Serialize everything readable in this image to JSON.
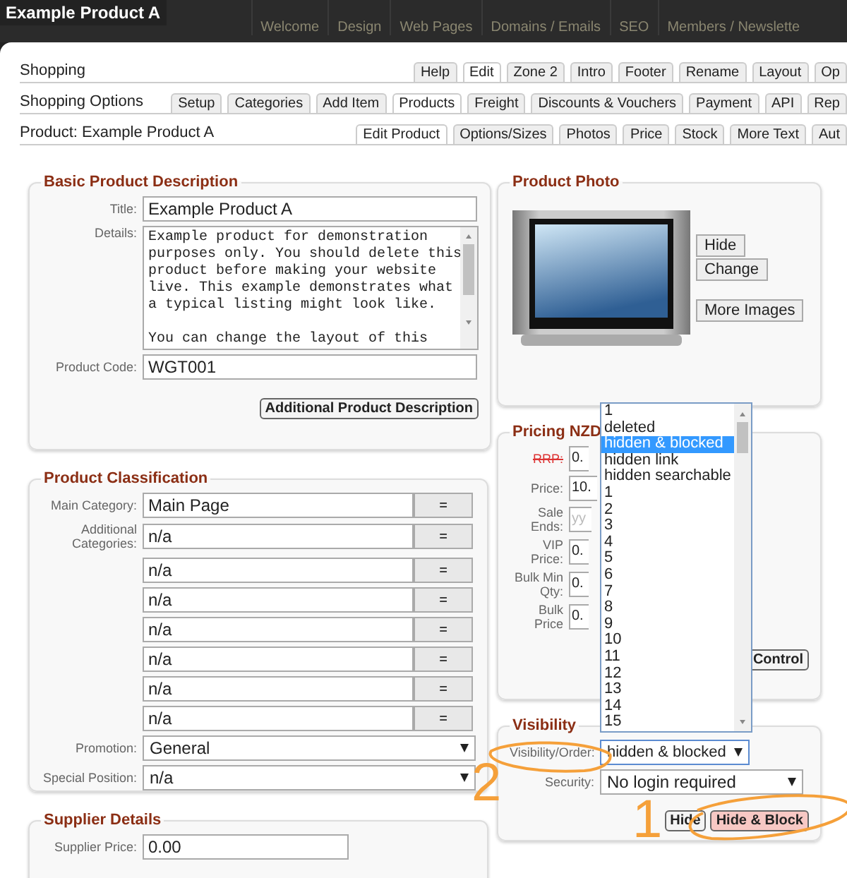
{
  "header": {
    "title": "Example Product A",
    "nav": [
      "Welcome",
      "Design",
      "Web Pages",
      "Domains / Emails",
      "SEO",
      "Members / Newslette"
    ]
  },
  "tab_rows": [
    {
      "label": "Shopping",
      "tabs": [
        {
          "label": "Help",
          "selected": false
        },
        {
          "label": "Edit",
          "selected": true
        },
        {
          "label": "Zone 2",
          "selected": false
        },
        {
          "label": "Intro",
          "selected": false
        },
        {
          "label": "Footer",
          "selected": false
        },
        {
          "label": "Rename",
          "selected": false
        },
        {
          "label": "Layout",
          "selected": false
        },
        {
          "label": "Op",
          "selected": false
        }
      ]
    },
    {
      "label": "Shopping Options",
      "tabs": [
        {
          "label": "Setup",
          "selected": false
        },
        {
          "label": "Categories",
          "selected": false
        },
        {
          "label": "Add Item",
          "selected": false
        },
        {
          "label": "Products",
          "selected": true
        },
        {
          "label": "Freight",
          "selected": false
        },
        {
          "label": "Discounts & Vouchers",
          "selected": false
        },
        {
          "label": "Payment",
          "selected": false
        },
        {
          "label": "API",
          "selected": false
        },
        {
          "label": "Rep",
          "selected": false
        }
      ]
    },
    {
      "label": "Product: Example Product A",
      "tabs": [
        {
          "label": "Edit Product",
          "selected": true
        },
        {
          "label": "Options/Sizes",
          "selected": false
        },
        {
          "label": "Photos",
          "selected": false
        },
        {
          "label": "Price",
          "selected": false
        },
        {
          "label": "Stock",
          "selected": false
        },
        {
          "label": "More Text",
          "selected": false
        },
        {
          "label": "Aut",
          "selected": false
        }
      ]
    }
  ],
  "basic": {
    "legend": "Basic Product Description",
    "title": {
      "label": "Title:",
      "value": "Example Product A"
    },
    "details": {
      "label": "Details:",
      "value": "Example product for demonstration\npurposes only. You should delete this\nproduct before making your website\nlive. This example demonstrates what\na typical listing might look like.\n\nYou can change the layout of this"
    },
    "code": {
      "label": "Product Code:",
      "value": "WGT001"
    },
    "button": "Additional Product Description"
  },
  "photo": {
    "legend": "Product Photo",
    "buttons": [
      "Hide",
      "Change",
      "More Images"
    ]
  },
  "classification": {
    "legend": "Product Classification",
    "main": {
      "label": "Main Category:",
      "value": "Main Page",
      "button": "="
    },
    "additional_label": "Additional Categories:",
    "additional": [
      {
        "value": "n/a",
        "button": "="
      },
      {
        "value": "n/a",
        "button": "="
      },
      {
        "value": "n/a",
        "button": "="
      },
      {
        "value": "n/a",
        "button": "="
      },
      {
        "value": "n/a",
        "button": "="
      },
      {
        "value": "n/a",
        "button": "="
      },
      {
        "value": "n/a",
        "button": "="
      }
    ],
    "promotion": {
      "label": "Promotion:",
      "value": "General"
    },
    "special": {
      "label": "Special Position:",
      "value": "n/a"
    }
  },
  "supplier": {
    "legend": "Supplier Details",
    "price": {
      "label": "Supplier Price:",
      "value": "0.00"
    }
  },
  "pricing": {
    "legend": "Pricing NZD",
    "fields": [
      {
        "label": "RRP:",
        "value": "0.",
        "struck": true
      },
      {
        "label": "Price:",
        "value": "10.",
        "struck": false
      },
      {
        "label": "Sale Ends:",
        "placeholder": "yy",
        "struck": false
      },
      {
        "label": "VIP Price:",
        "value": "0.",
        "struck": false
      },
      {
        "label": "Bulk Min Qty:",
        "value": "0.",
        "struck": false
      },
      {
        "label": "Bulk Price",
        "value": "0.",
        "struck": false
      }
    ],
    "button": "Control"
  },
  "visibility": {
    "legend": "Visibility",
    "order": {
      "label": "Visibility/Order:",
      "value": "hidden & blocked"
    },
    "security": {
      "label": "Security:",
      "value": "No login required"
    },
    "buttons": [
      {
        "label": "Hide",
        "highlighted": false
      },
      {
        "label": "Hide & Block",
        "highlighted": true
      }
    ]
  },
  "dropdown": {
    "options": [
      {
        "label": "1",
        "selected": false
      },
      {
        "label": "deleted",
        "selected": false
      },
      {
        "label": "hidden & blocked",
        "selected": true
      },
      {
        "label": "hidden link",
        "selected": false
      },
      {
        "label": "hidden searchable",
        "selected": false
      },
      {
        "label": "1",
        "selected": false
      },
      {
        "label": "2",
        "selected": false
      },
      {
        "label": "3",
        "selected": false
      },
      {
        "label": "4",
        "selected": false
      },
      {
        "label": "5",
        "selected": false
      },
      {
        "label": "6",
        "selected": false
      },
      {
        "label": "7",
        "selected": false
      },
      {
        "label": "8",
        "selected": false
      },
      {
        "label": "9",
        "selected": false
      },
      {
        "label": "10",
        "selected": false
      },
      {
        "label": "11",
        "selected": false
      },
      {
        "label": "12",
        "selected": false
      },
      {
        "label": "13",
        "selected": false
      },
      {
        "label": "14",
        "selected": false
      },
      {
        "label": "15",
        "selected": false
      }
    ]
  },
  "annotations": [
    "1",
    "2"
  ]
}
